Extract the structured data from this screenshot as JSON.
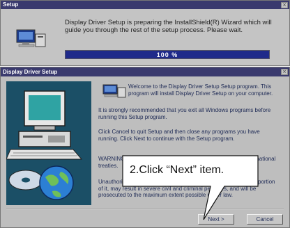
{
  "setup_window": {
    "title": "Setup",
    "close_glyph": "×",
    "message": "Display Driver Setup is preparing the InstallShield(R) Wizard which will guide you through the rest of the setup process. Please wait.",
    "progress_label": "100 %",
    "progress_percent": 100
  },
  "driver_window": {
    "title": "Display Driver Setup",
    "close_glyph": "×",
    "welcome_text": "Welcome to the Display Driver Setup Setup program. This program will install Display Driver Setup on your computer.",
    "recommend_text": "It is strongly recommended that you exit all Windows programs before running this Setup program.",
    "cancel_info_text": "Click Cancel to quit Setup and then close any programs you have running. Click Next to continue with the Setup program.",
    "warning_text": "WARNING: This program is protected by copyright law and international treaties.",
    "law_text": "Unauthorized reproduction or distribution of this program, or any portion of it, may result in severe civil and criminal penalties, and will be prosecuted to the maximum extent possible under law.",
    "buttons": {
      "next": "Next >",
      "cancel": "Cancel"
    }
  },
  "callout": {
    "text": "2.Click “Next” item."
  },
  "icons": {
    "setup_icon": "computer-setup-icon",
    "welcome_icon": "computer-setup-icon",
    "side_art": "computer-globe-illustration"
  }
}
